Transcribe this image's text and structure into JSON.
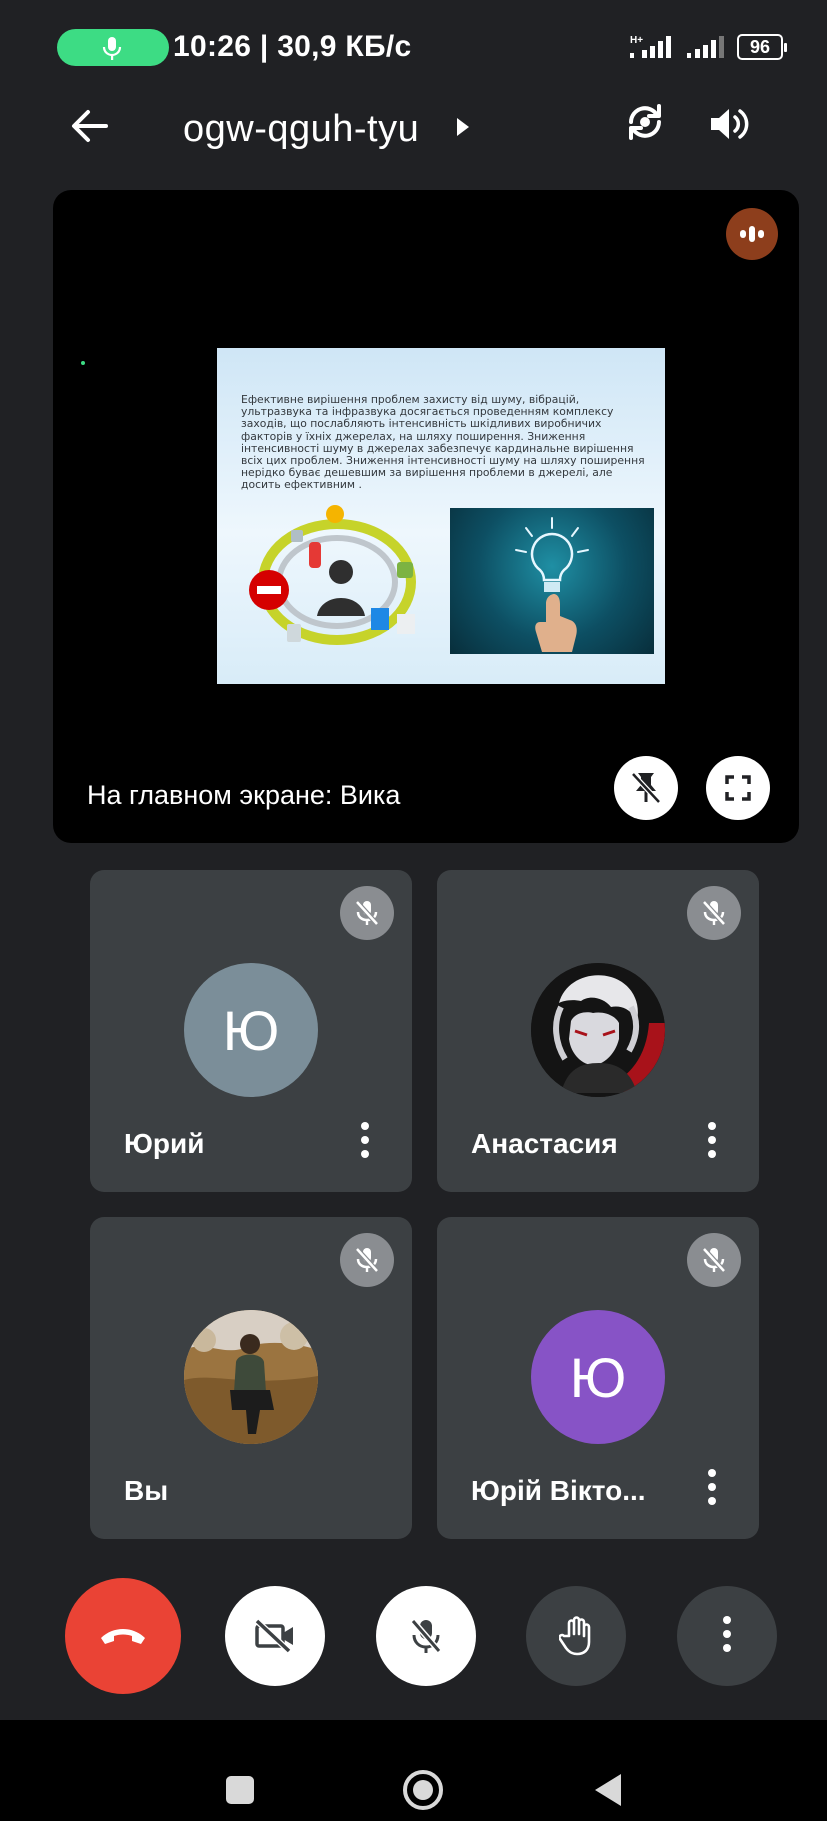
{
  "status_bar": {
    "time_speed": "10:26 | 30,9 КБ/с",
    "network_type": "H+",
    "battery_level": "96",
    "mic_indicator_color": "#3ddc84"
  },
  "header": {
    "meeting_code": "ogw-qguh-tyu",
    "icons": [
      "back-arrow-icon",
      "caret-right-icon",
      "switch-camera-icon",
      "speaker-icon"
    ]
  },
  "presentation": {
    "slide_text": "Ефективне вирішення проблем захисту від шуму, вібрацій, ультразвука та інфразвука досягається проведенням комплексу заходів, що послабляють інтенсивність шкідливих виробничих факторів у їхніх джерелах, на шляху поширення. Зниження інтенсивності шуму в джерелах забезпечує кардинальне вирішення всіх цих проблем. Зниження інтенсивності шуму на шляху поширення нерідко буває дешевшим за вирішення проблеми в джерелі, але досить ефективним .",
    "presenter_label": "На главном экране: Вика",
    "speaking_badge_color": "#8d3e1c"
  },
  "participants": [
    {
      "name": "Юрий",
      "initial": "Ю",
      "avatar_color": "#7b8e99",
      "muted": true
    },
    {
      "name": "Анастасия",
      "initial": "",
      "avatar_color": "#1a1a1a",
      "muted": true
    },
    {
      "name": "Вы",
      "initial": "",
      "avatar_color": "#8a6a3a",
      "muted": true
    },
    {
      "name": "Юрій Вікто...",
      "initial": "Ю",
      "avatar_color": "#8753c6",
      "muted": true
    }
  ],
  "controls": {
    "end_call_color": "#ea4335",
    "items": [
      "end-call",
      "camera-off",
      "mic-off",
      "raise-hand",
      "more-options"
    ]
  },
  "colors": {
    "background": "#202124",
    "tile": "#3c4043",
    "main_tile": "#000000"
  }
}
